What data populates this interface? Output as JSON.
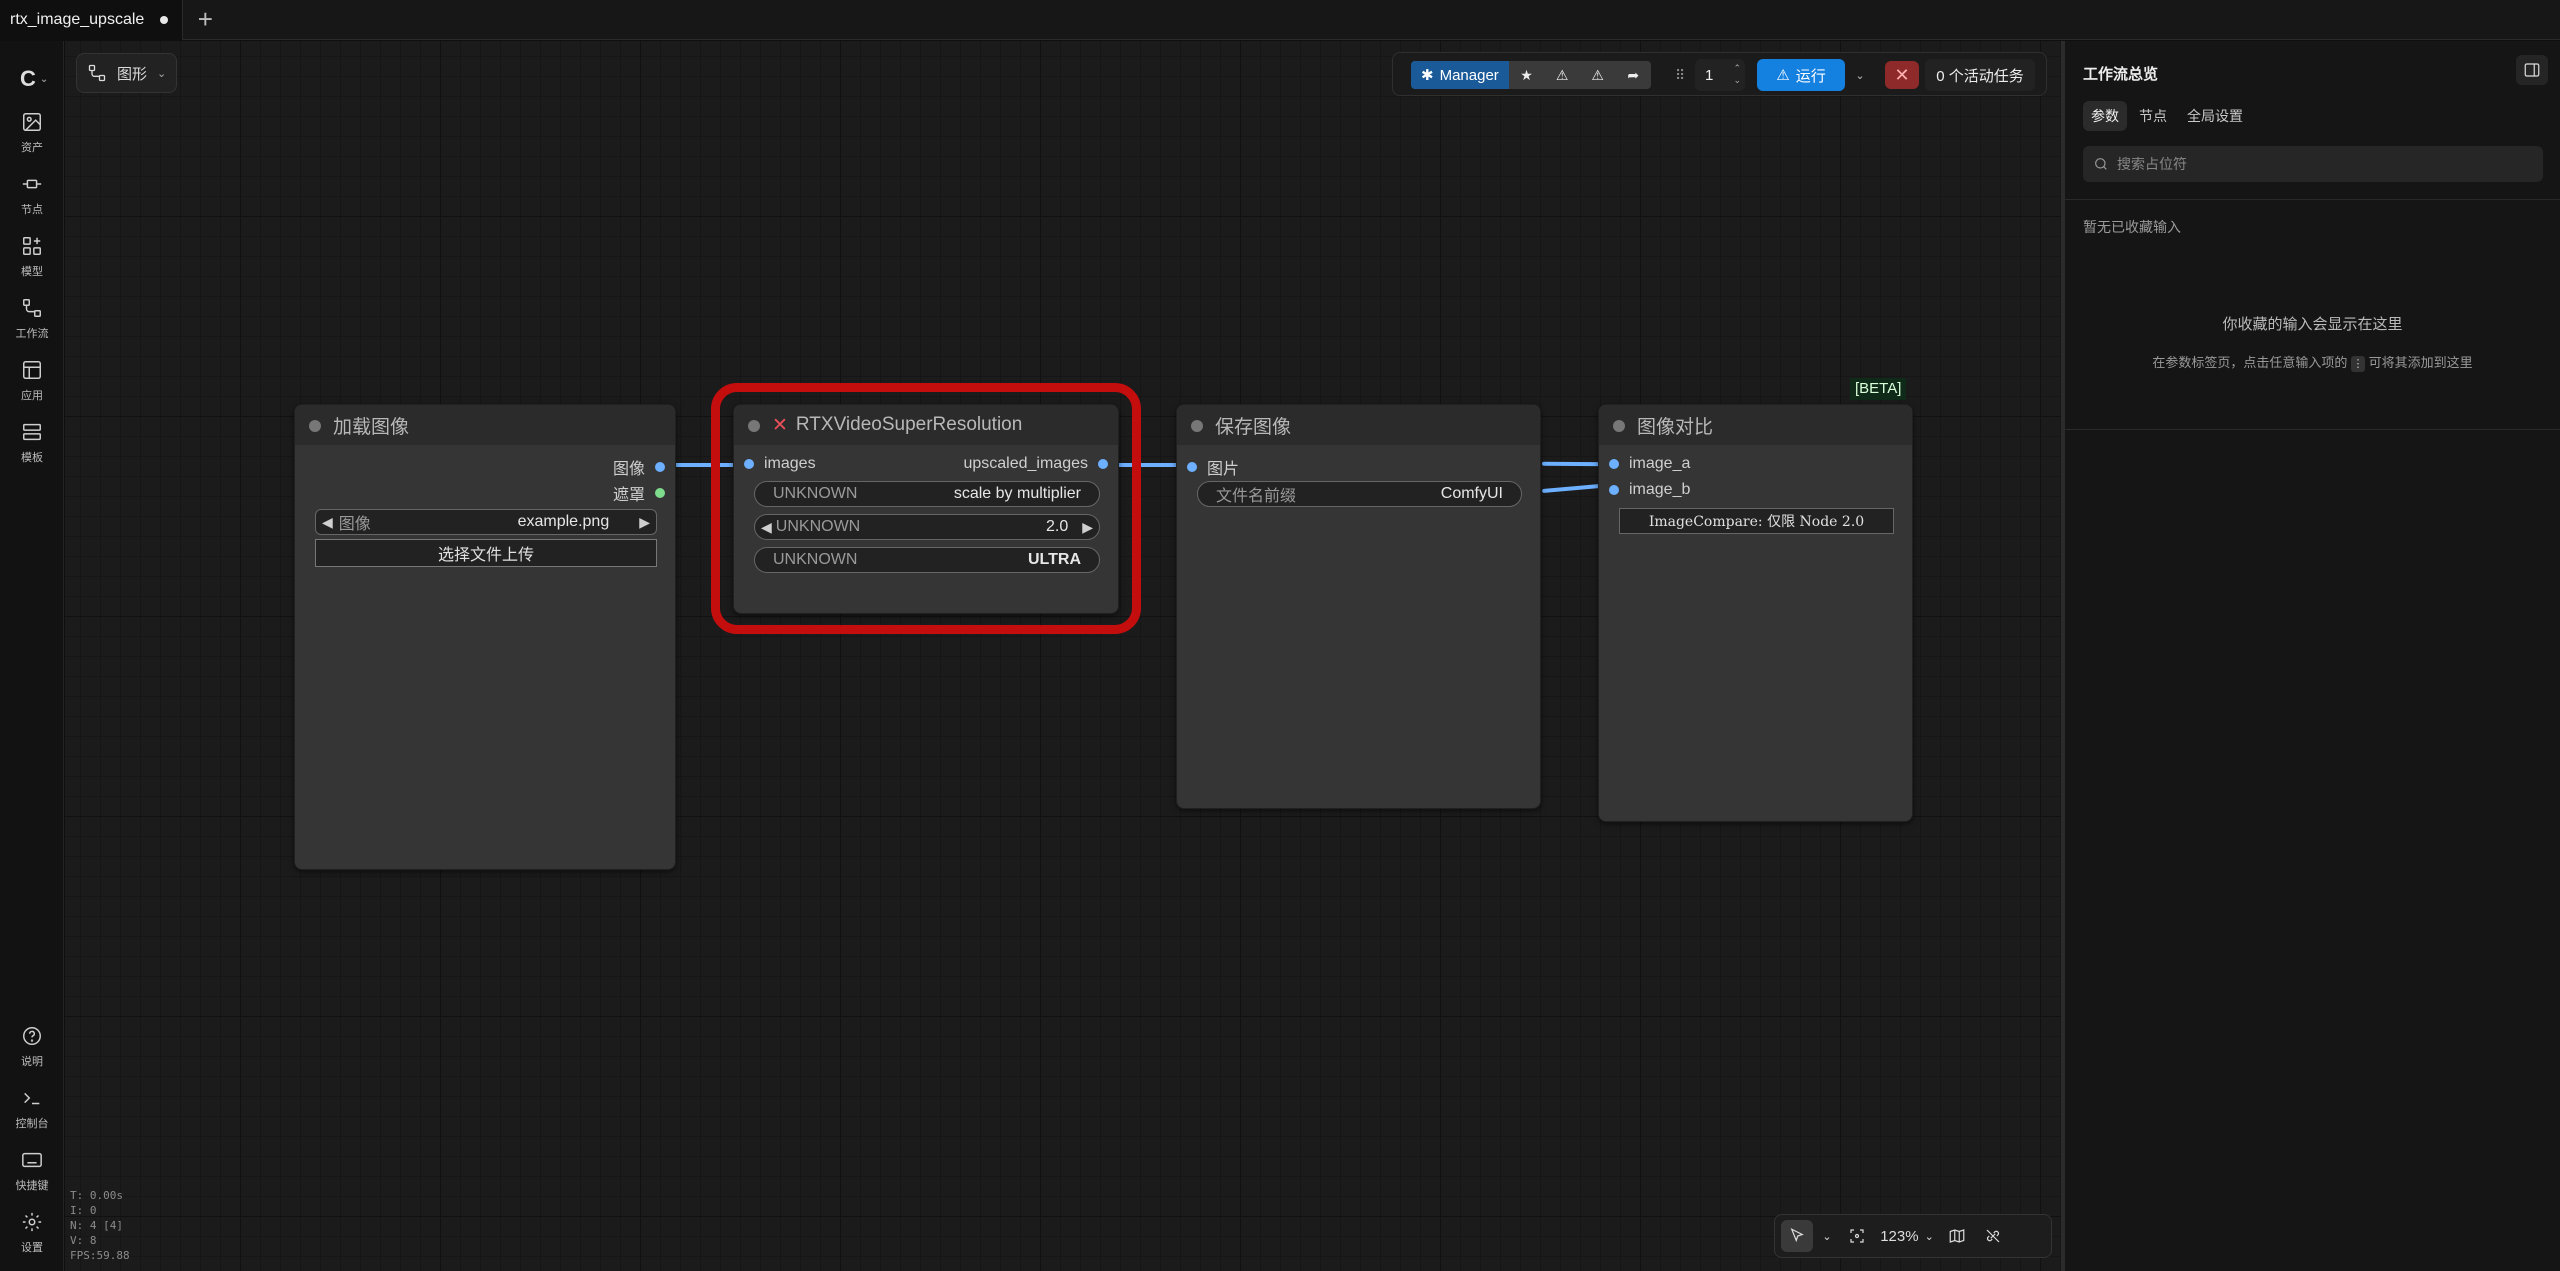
{
  "tab": {
    "title": "rtx_image_upscale",
    "add_label": "+"
  },
  "graph_menu": {
    "label": "图形"
  },
  "sidebar": {
    "items": [
      {
        "label": "资产",
        "icon": "image-icon"
      },
      {
        "label": "节点",
        "icon": "node-icon"
      },
      {
        "label": "模型",
        "icon": "model-icon"
      },
      {
        "label": "工作流",
        "icon": "workflow-icon"
      },
      {
        "label": "应用",
        "icon": "app-icon"
      },
      {
        "label": "模板",
        "icon": "template-icon"
      }
    ],
    "bottom_items": [
      {
        "label": "说明",
        "icon": "help-icon"
      },
      {
        "label": "控制台",
        "icon": "terminal-icon"
      },
      {
        "label": "快捷键",
        "icon": "keyboard-icon"
      },
      {
        "label": "设置",
        "icon": "gear-icon"
      }
    ],
    "stats": [
      "T: 0.00s",
      "I: 0",
      "N: 4 [4]",
      "V: 8",
      "FPS:59.88"
    ]
  },
  "toolbar": {
    "manager_label": "Manager",
    "queue_count": "1",
    "run_label": "运行",
    "stop_label": "✕",
    "active_jobs": "0 个活动任务"
  },
  "nodes": {
    "load_image": {
      "title": "加载图像",
      "outputs": [
        "图像",
        "遮罩"
      ],
      "image_widget": {
        "label": "图像",
        "value": "example.png"
      },
      "upload_label": "选择文件上传"
    },
    "rtx": {
      "title": "RTXVideoSuperResolution",
      "input": "images",
      "output": "upscaled_images",
      "widgets": [
        {
          "label": "UNKNOWN",
          "value": "scale by multiplier"
        },
        {
          "label": "UNKNOWN",
          "value": "2.0"
        },
        {
          "label": "UNKNOWN",
          "value": "ULTRA"
        }
      ]
    },
    "save_image": {
      "title": "保存图像",
      "input": "图片",
      "prefix_widget": {
        "label": "文件名前缀",
        "value": "ComfyUI"
      }
    },
    "compare": {
      "title": "图像对比",
      "badge": "[BETA]",
      "inputs": [
        "image_a",
        "image_b"
      ],
      "note": "ImageCompare: 仅限 Node 2.0"
    }
  },
  "zoom": {
    "level": "123%"
  },
  "right_panel": {
    "title": "工作流总览",
    "tabs": [
      "参数",
      "节点",
      "全局设置"
    ],
    "search_placeholder": "搜索占位符",
    "favorites_label": "暂无已收藏输入",
    "empty_title": "你收藏的输入会显示在这里",
    "empty_hint_before": "在参数标签页，点击任意输入项的",
    "empty_hint_after": "可将其添加到这里"
  },
  "colors": {
    "accent": "#1480e0",
    "manager": "#1b5a98",
    "error_outline": "#c40e0e",
    "wire": "#6cb0ff"
  }
}
